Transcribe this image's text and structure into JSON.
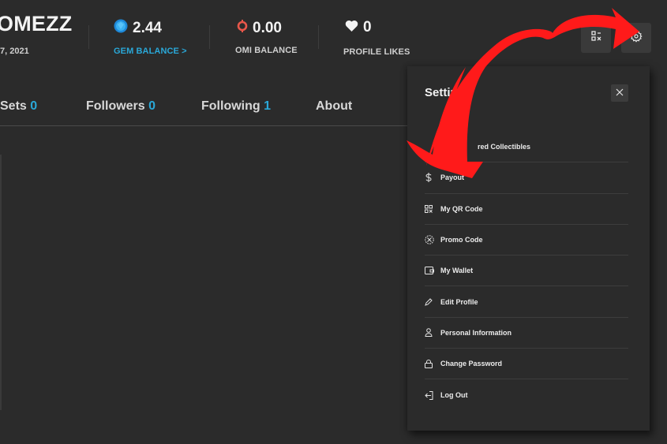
{
  "profile": {
    "username": "OMEZZ",
    "joined": "7, 2021"
  },
  "stats": [
    {
      "icon": "gem-icon",
      "value": "2.44",
      "label": "GEM BALANCE",
      "suffix": ">"
    },
    {
      "icon": "omi-icon",
      "value": "0.00",
      "label": "OMI BALANCE"
    },
    {
      "icon": "heart-icon",
      "value": "0",
      "label": "PROFILE LIKES"
    }
  ],
  "header_actions": {
    "qr_button": "qr-code-icon",
    "settings_button": "gear-icon"
  },
  "tabs": [
    {
      "label": "Sets",
      "count": "0"
    },
    {
      "label": "Followers",
      "count": "0"
    },
    {
      "label": "Following",
      "count": "1"
    },
    {
      "label": "About",
      "count": ""
    }
  ],
  "settings_panel": {
    "title": "Settings",
    "close_icon": "close-icon",
    "items": [
      {
        "icon": "collectibles-icon",
        "label": "red Collectibles"
      },
      {
        "icon": "dollar-icon",
        "label": "Payout"
      },
      {
        "icon": "qr-code-icon",
        "label": "My QR Code"
      },
      {
        "icon": "promo-icon",
        "label": "Promo Code"
      },
      {
        "icon": "wallet-icon",
        "label": "My Wallet"
      },
      {
        "icon": "pencil-icon",
        "label": "Edit Profile"
      },
      {
        "icon": "user-icon",
        "label": "Personal Information"
      },
      {
        "icon": "lock-icon",
        "label": "Change Password"
      },
      {
        "icon": "logout-icon",
        "label": "Log Out"
      }
    ]
  },
  "colors": {
    "background": "#2b2b2b",
    "accent": "#2aa8d8",
    "omi": "#e8574a",
    "annotation_arrow": "#ff1a1a"
  }
}
